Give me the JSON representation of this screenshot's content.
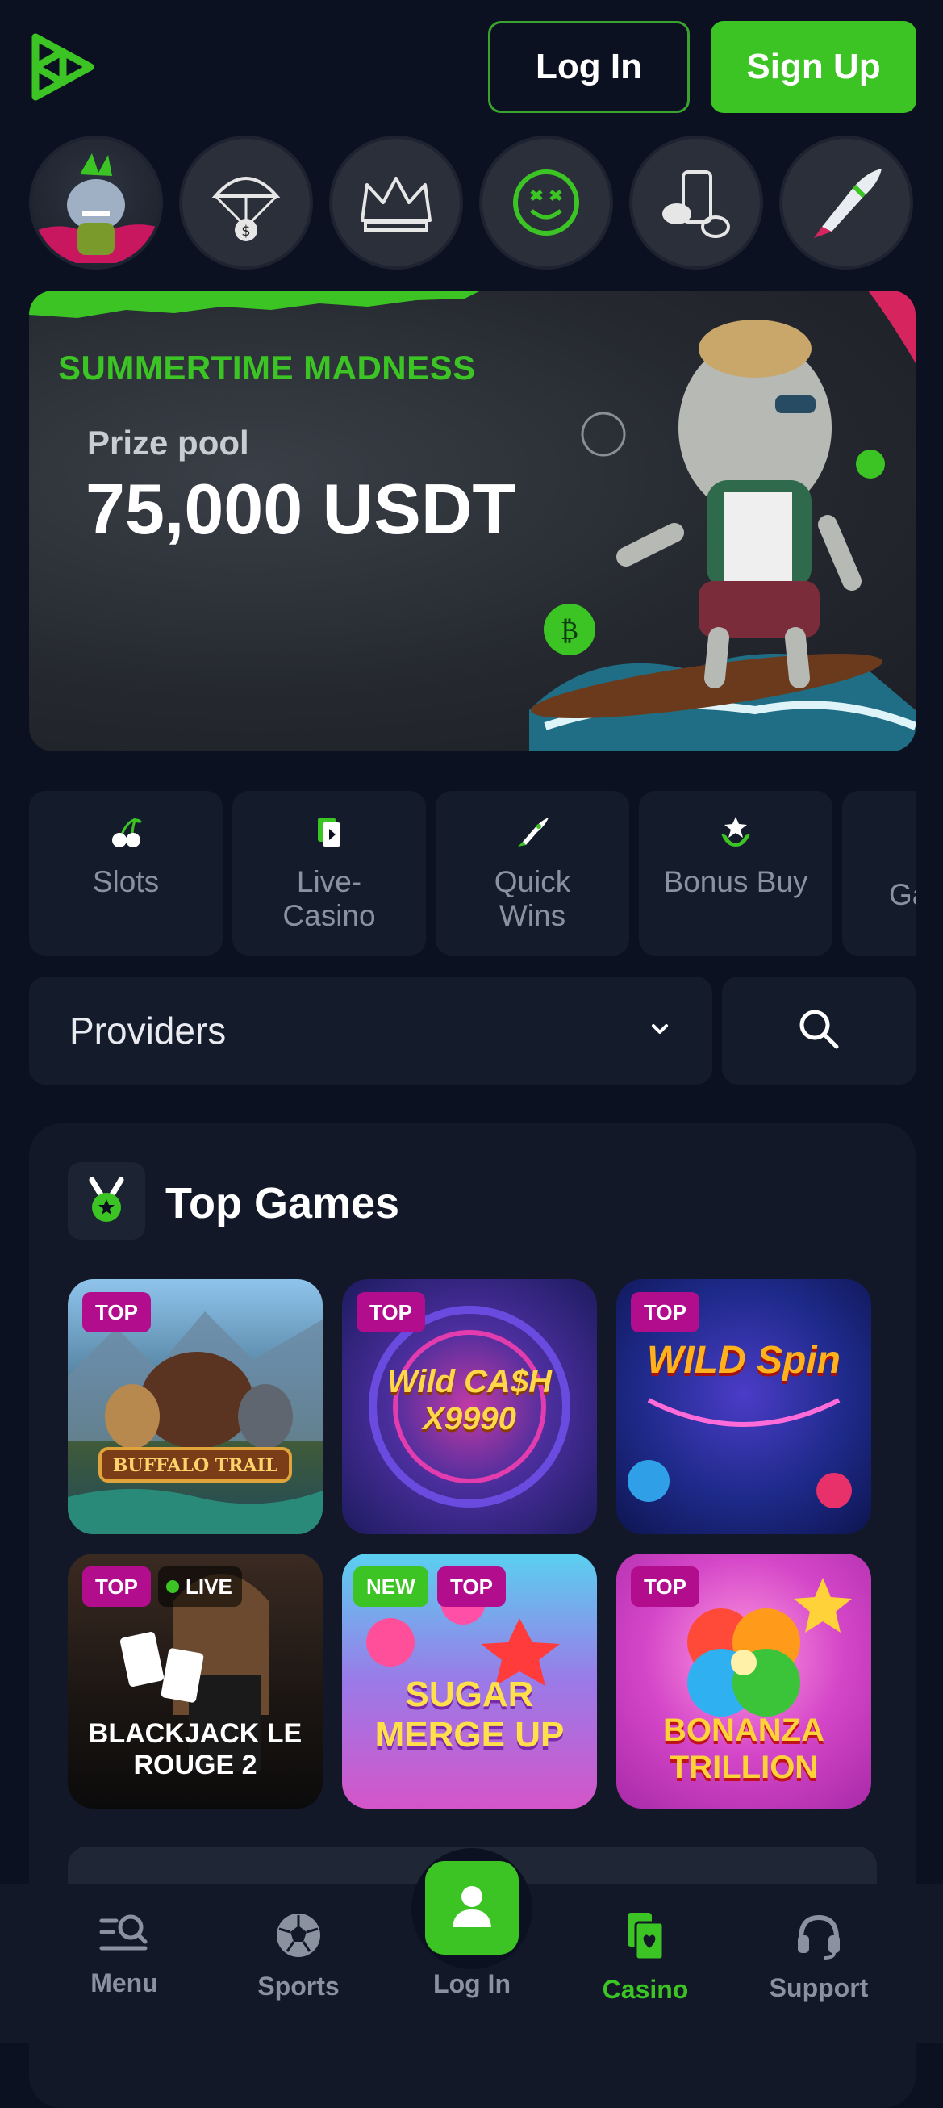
{
  "colors": {
    "accent": "#3bc424",
    "background": "#0b1120",
    "badge_top": "#b10d8c",
    "badge_new": "#3bc424"
  },
  "header": {
    "logo_icon": "play-logo-icon",
    "login_label": "Log In",
    "signup_label": "Sign Up"
  },
  "stories": [
    {
      "name": "shark-mascot"
    },
    {
      "name": "parachute-coin"
    },
    {
      "name": "crown"
    },
    {
      "name": "smiley-coin"
    },
    {
      "name": "chat-phone"
    },
    {
      "name": "rocket"
    }
  ],
  "banner": {
    "tag": "SUMMERTIME MADNESS",
    "subtitle": "Prize pool",
    "amount": "75,000 USDT"
  },
  "categories": [
    {
      "label": "Slots",
      "icon": "cherry-icon"
    },
    {
      "label": "Live-\nCasino",
      "icon": "live-card-icon"
    },
    {
      "label": "Quick\nWins",
      "icon": "rocket-icon"
    },
    {
      "label": "Bonus Buy",
      "icon": "star-hand-icon"
    },
    {
      "label": "Ga",
      "icon": "game-icon"
    }
  ],
  "providers": {
    "label": "Providers"
  },
  "top_games": {
    "title": "Top Games",
    "games": [
      {
        "name": "BUFFALO TRAIL",
        "badges": [
          "TOP"
        ]
      },
      {
        "name": "Wild CA$H X9990",
        "badges": [
          "TOP"
        ]
      },
      {
        "name": "WILD Spin",
        "badges": [
          "TOP"
        ]
      },
      {
        "name": "BLACKJACK LE ROUGE 2",
        "badges": [
          "TOP",
          "LIVE"
        ]
      },
      {
        "name": "SUGAR MERGE UP",
        "badges": [
          "NEW",
          "TOP"
        ]
      },
      {
        "name": "BONANZA TRILLION",
        "badges": [
          "TOP"
        ]
      }
    ]
  },
  "bottom_nav": {
    "menu": "Menu",
    "sports": "Sports",
    "login": "Log In",
    "casino": "Casino",
    "support": "Support"
  }
}
